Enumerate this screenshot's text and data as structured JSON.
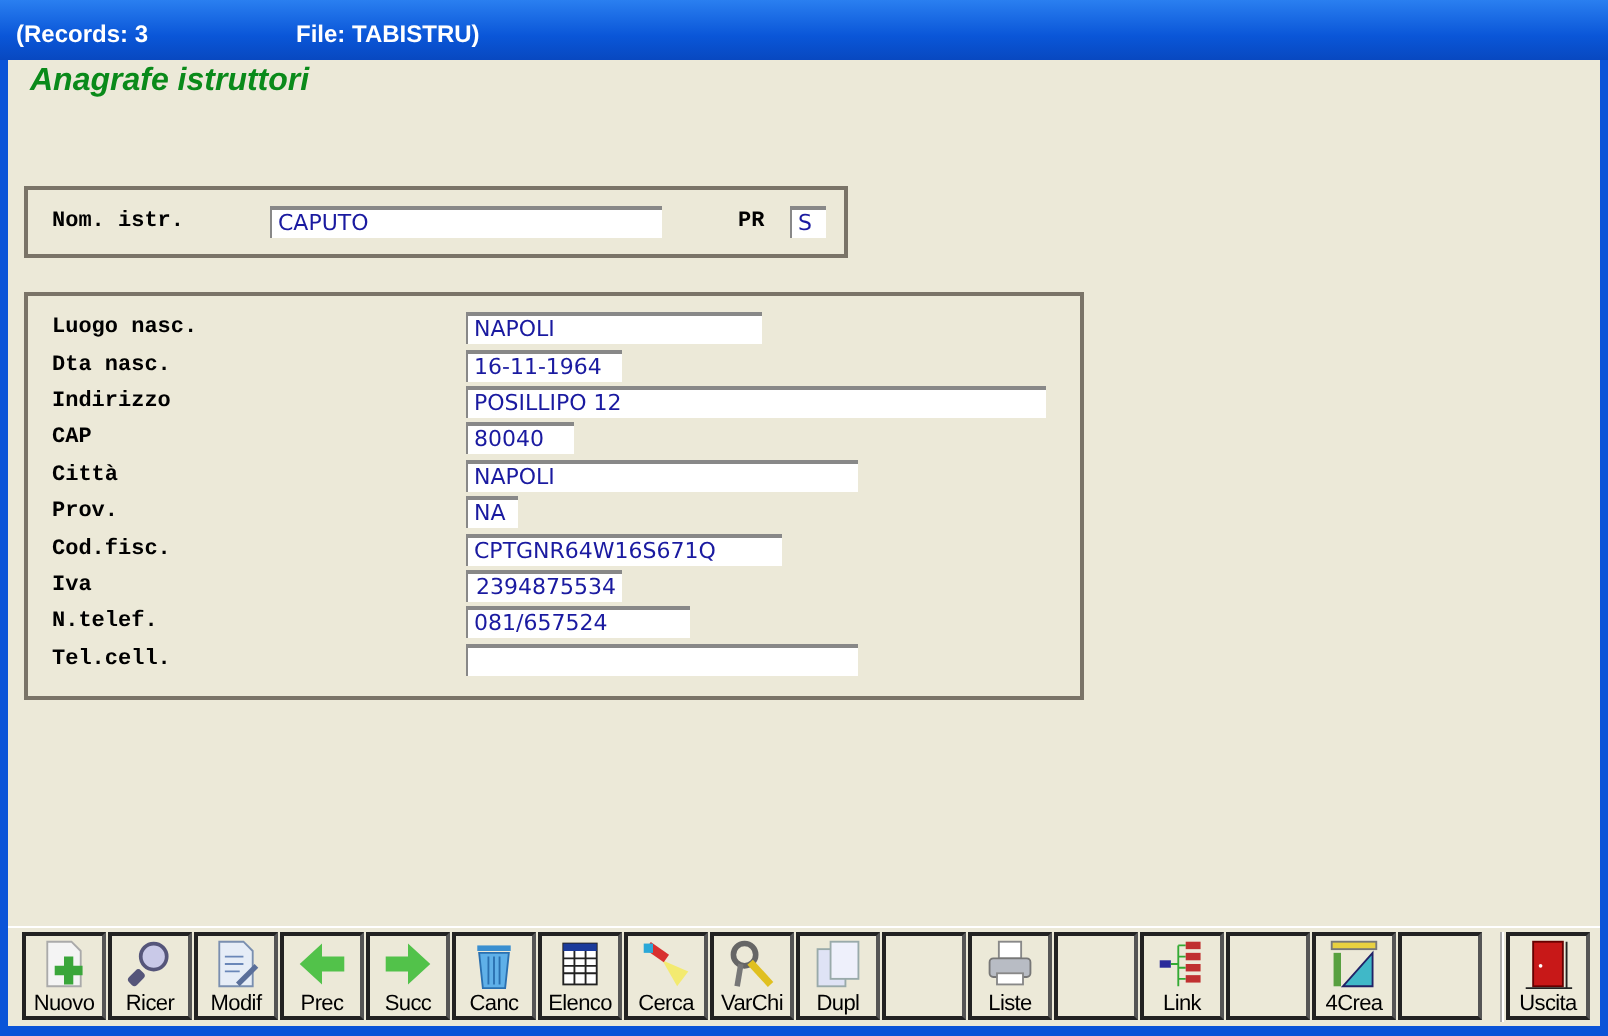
{
  "window": {
    "title_parts": [
      "(Records: 3",
      "File: TABISTRU)"
    ]
  },
  "heading": "Anagrafe istruttori",
  "header_panel": {
    "fields": [
      {
        "label": "Nom. istr.",
        "value": "CAPUTO"
      },
      {
        "label": "PR",
        "value": "S"
      }
    ]
  },
  "detail_panel": {
    "fields": [
      {
        "label": "Luogo nasc.",
        "value": "NAPOLI"
      },
      {
        "label": "Dta nasc.",
        "value": "16-11-1964"
      },
      {
        "label": "Indirizzo",
        "value": "POSILLIPO 12"
      },
      {
        "label": "CAP",
        "value": "80040"
      },
      {
        "label": "Città",
        "value": "NAPOLI"
      },
      {
        "label": "Prov.",
        "value": "NA"
      },
      {
        "label": "Cod.fisc.",
        "value": "CPTGNR64W16S671Q"
      },
      {
        "label": "Iva",
        "value": "2394875534"
      },
      {
        "label": "N.telef.",
        "value": "081/657524"
      },
      {
        "label": "Tel.cell."
      }
    ]
  },
  "toolbar": [
    {
      "kind": "new",
      "label": "Nuovo"
    },
    {
      "kind": "magnifier",
      "label": "Ricer"
    },
    {
      "kind": "edit",
      "label": "Modif"
    },
    {
      "kind": "prev",
      "label": "Prec"
    },
    {
      "kind": "next",
      "label": "Succ"
    },
    {
      "kind": "trash",
      "label": "Canc"
    },
    {
      "kind": "table",
      "label": "Elenco"
    },
    {
      "kind": "torch",
      "label": "Cerca"
    },
    {
      "kind": "keys",
      "label": "VarChi"
    },
    {
      "kind": "copy",
      "label": "Dupl"
    },
    {
      "kind": "blank"
    },
    {
      "kind": "printer",
      "label": "Liste"
    },
    {
      "kind": "blank"
    },
    {
      "kind": "tree",
      "label": "Link"
    },
    {
      "kind": "blank"
    },
    {
      "kind": "ruler",
      "label": "4Crea"
    },
    {
      "kind": "blank"
    },
    {
      "kind": "gap"
    },
    {
      "kind": "door",
      "label": "Uscita"
    }
  ]
}
